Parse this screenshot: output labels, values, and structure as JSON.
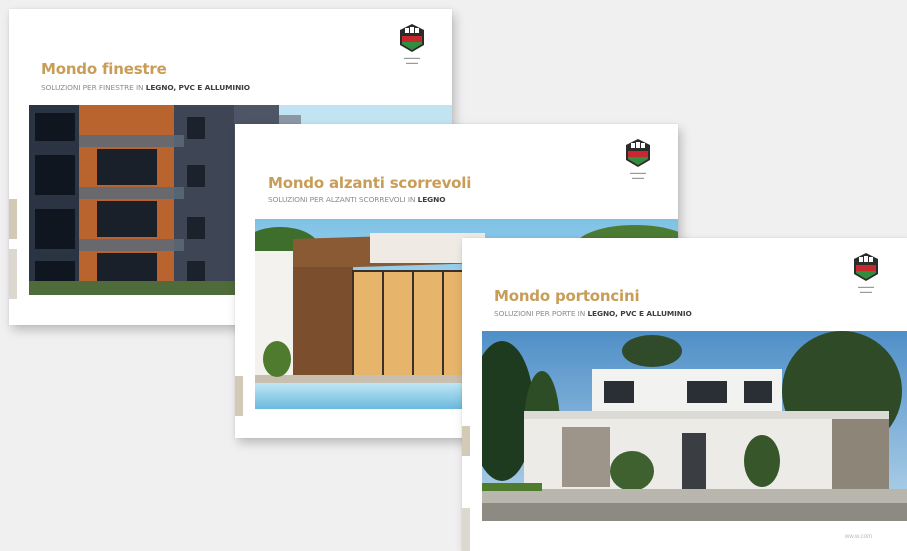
{
  "brochures": [
    {
      "title": "Mondo finestre",
      "subtitle_prefix": "SOLUZIONI PER FINESTRE IN ",
      "subtitle_materials": "LEGNO, PVC E ALLUMINIO",
      "photo": "apartment-building-balconies",
      "logo": "shield-logo-icon"
    },
    {
      "title": "Mondo alzanti scorrevoli",
      "subtitle_prefix": "SOLUZIONI PER ALZANTI SCORREVOLI IN ",
      "subtitle_materials": "LEGNO",
      "photo": "modern-villa-pool-sliding-doors",
      "logo": "shield-logo-icon"
    },
    {
      "title": "Mondo portoncini",
      "subtitle_prefix": "SOLUZIONI PER PORTE IN ",
      "subtitle_materials": "LEGNO, PVC E ALLUMINIO",
      "photo": "modern-white-house-garden",
      "logo": "shield-logo-icon",
      "website": "ww.w.com"
    }
  ],
  "colors": {
    "title_gold": "#c89d58",
    "logo_red": "#c7282e",
    "logo_green": "#2f8f3e",
    "logo_dark": "#2b2b2b",
    "background": "#f1f0f1"
  }
}
